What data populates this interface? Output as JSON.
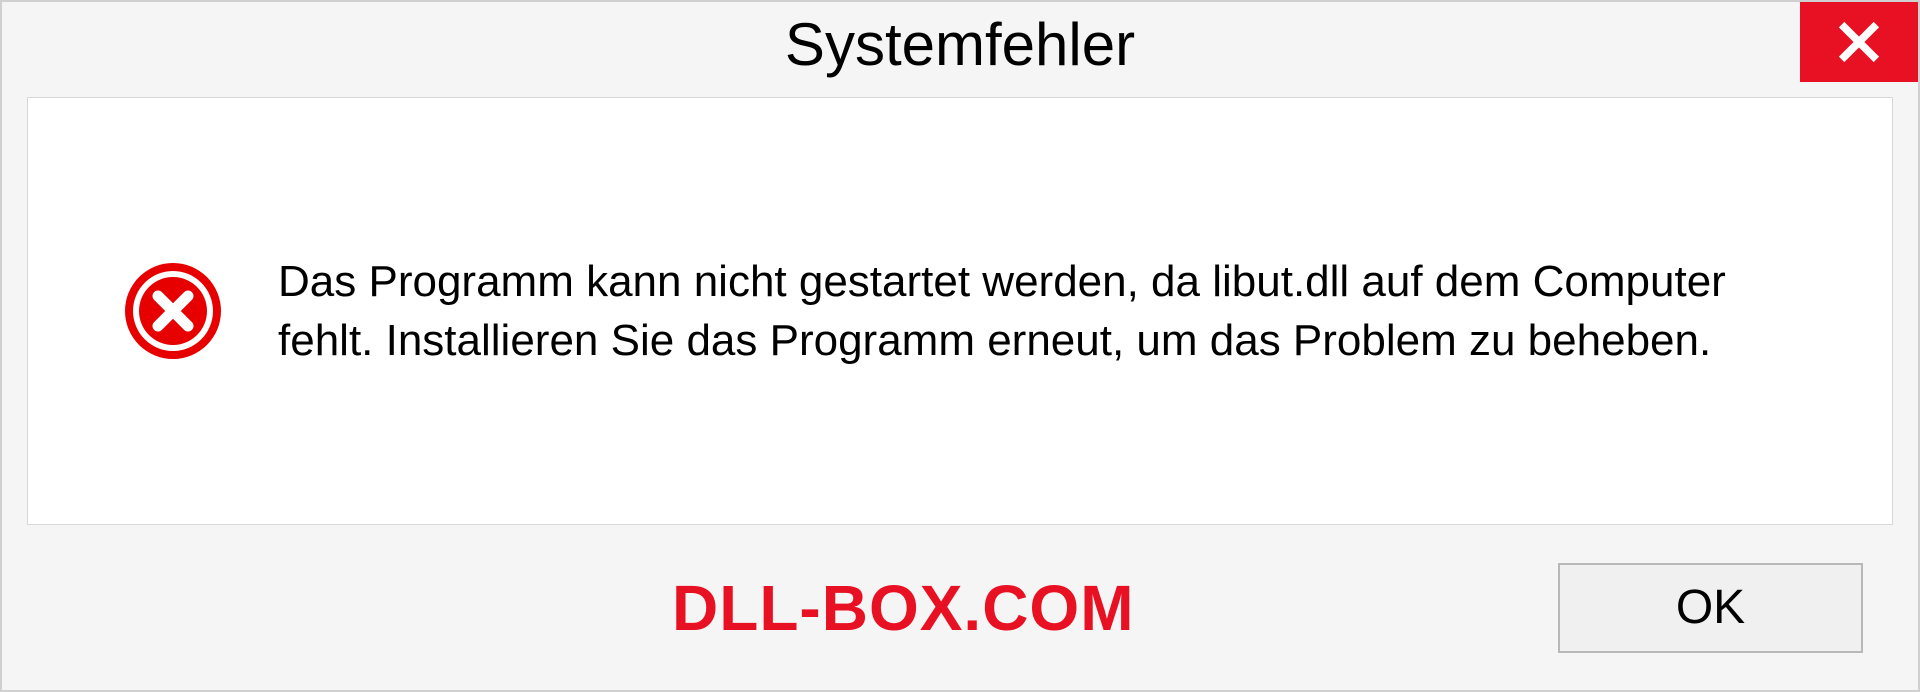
{
  "dialog": {
    "title": "Systemfehler",
    "message": "Das Programm kann nicht gestartet werden, da libut.dll auf dem Computer fehlt. Installieren Sie das Programm erneut, um das Problem zu beheben.",
    "ok_label": "OK"
  },
  "watermark": "DLL-BOX.COM",
  "colors": {
    "close_bg": "#e81123",
    "error_icon": "#e81123",
    "watermark": "#e81123"
  }
}
